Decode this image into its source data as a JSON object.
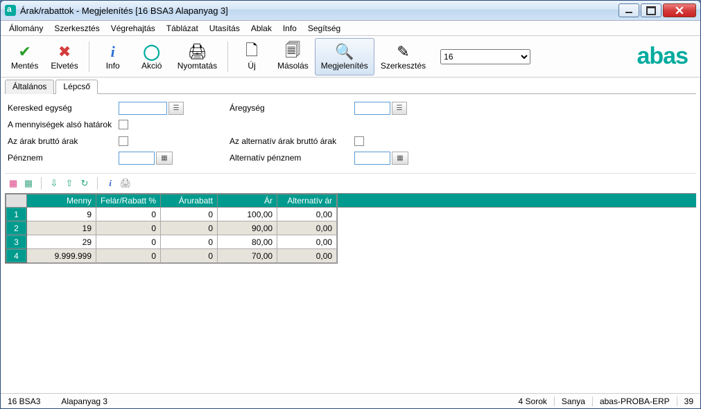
{
  "window": {
    "title": "Árak/rabattok - Megjelenítés  [16   BSA3   Alapanyag 3]"
  },
  "menu": [
    "Állomány",
    "Szerkesztés",
    "Végrehajtás",
    "Táblázat",
    "Utasítás",
    "Ablak",
    "Info",
    "Segítség"
  ],
  "toolbar": {
    "mentes": "Mentés",
    "elvetes": "Elvetés",
    "info": "Info",
    "akcio": "Akció",
    "nyomtatas": "Nyomtatás",
    "uj": "Új",
    "masolas": "Másolás",
    "megjelenites": "Megjelenítés",
    "szerkesztes": "Szerkesztés",
    "combo_value": "16"
  },
  "brand": "abas",
  "tabs": {
    "altalanos": "Általános",
    "lepcso": "Lépcső"
  },
  "form": {
    "keresked_egyseg": "Keresked egység",
    "ar_egyseg": "Áregység",
    "mennyisegek_also": "A mennyiségek alsó határok",
    "arak_brutto": "Az árak bruttó árak",
    "alt_brutto": "Az alternatív árak bruttó árak",
    "penznem": "Pénznem",
    "alt_penznem": "Alternatív pénznem"
  },
  "grid": {
    "headers": [
      "Menny",
      "Felár/Rabatt %",
      "Árurabatt",
      "Ár",
      "Alternatív ár"
    ],
    "rows": [
      {
        "n": "1",
        "menny": "9",
        "felar": "0",
        "arurabatt": "0",
        "ar": "100,00",
        "alt": "0,00"
      },
      {
        "n": "2",
        "menny": "19",
        "felar": "0",
        "arurabatt": "0",
        "ar": "90,00",
        "alt": "0,00"
      },
      {
        "n": "3",
        "menny": "29",
        "felar": "0",
        "arurabatt": "0",
        "ar": "80,00",
        "alt": "0,00"
      },
      {
        "n": "4",
        "menny": "9.999.999",
        "felar": "0",
        "arurabatt": "0",
        "ar": "70,00",
        "alt": "0,00"
      }
    ]
  },
  "status": {
    "code": "16 BSA3",
    "desc": "Alapanyag 3",
    "sorok": "4 Sorok",
    "user": "Sanya",
    "server": "abas-PROBA-ERP",
    "num": "39"
  }
}
